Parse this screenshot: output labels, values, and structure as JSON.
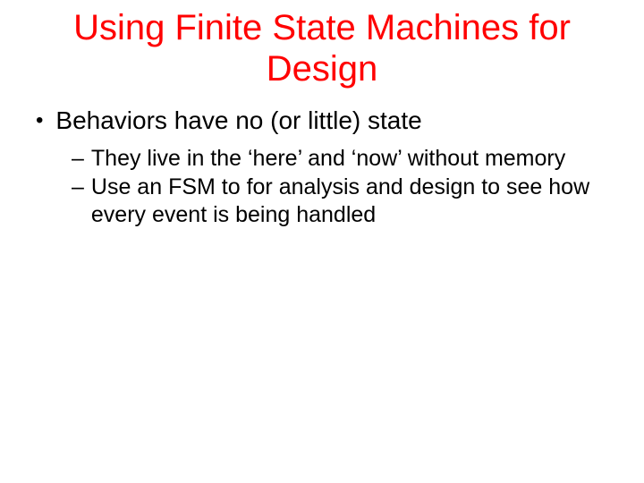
{
  "slide": {
    "title": "Using Finite State Machines for Design",
    "bullets": [
      {
        "text": "Behaviors have no (or little) state",
        "subbullets": [
          "They live in the ‘here’ and ‘now’ without memory",
          "Use an FSM to for analysis and design to see how every event is being handled"
        ]
      }
    ]
  }
}
